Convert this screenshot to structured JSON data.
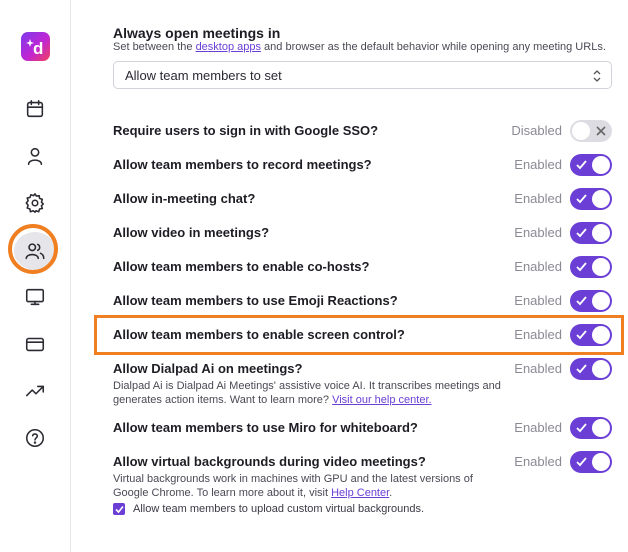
{
  "sidebar": {
    "logo_letter": "d",
    "items": [
      {
        "icon": "calendar-icon"
      },
      {
        "icon": "person-icon"
      },
      {
        "icon": "gear-icon"
      },
      {
        "icon": "users-icon",
        "active": true
      },
      {
        "icon": "monitor-icon"
      },
      {
        "icon": "credit-card-icon"
      },
      {
        "icon": "trending-up-icon"
      },
      {
        "icon": "help-icon"
      }
    ]
  },
  "meetings_setting": {
    "title": "Always open meetings in",
    "desc_before": "Set between the ",
    "desc_link": "desktop apps",
    "desc_after": " and browser as the default behavior while opening any meeting URLs.",
    "select_value": "Allow team members to set"
  },
  "settings": [
    {
      "label": "Require users to sign in with Google SSO?",
      "status": "Disabled",
      "enabled": false
    },
    {
      "label": "Allow team members to record meetings?",
      "status": "Enabled",
      "enabled": true
    },
    {
      "label": "Allow in-meeting chat?",
      "status": "Enabled",
      "enabled": true
    },
    {
      "label": "Allow video in meetings?",
      "status": "Enabled",
      "enabled": true
    },
    {
      "label": "Allow team members to enable co-hosts?",
      "status": "Enabled",
      "enabled": true
    },
    {
      "label": "Allow team members to use Emoji Reactions?",
      "status": "Enabled",
      "enabled": true
    },
    {
      "label": "Allow team members to enable screen control?",
      "status": "Enabled",
      "enabled": true
    },
    {
      "label": "Allow Dialpad Ai on meetings?",
      "status": "Enabled",
      "enabled": true,
      "desc_before": "Dialpad Ai is Dialpad Ai Meetings' assistive voice AI. It transcribes meetings and generates action items. Want to learn more? ",
      "desc_link": "Visit our help center.",
      "desc_after": ""
    },
    {
      "label": "Allow team members to use Miro for whiteboard?",
      "status": "Enabled",
      "enabled": true
    },
    {
      "label": "Allow virtual backgrounds during video meetings?",
      "status": "Enabled",
      "enabled": true,
      "desc_before": "Virtual backgrounds work in machines with GPU and the latest versions of Google Chrome. To learn more about it, visit ",
      "desc_link": "Help Center",
      "desc_after": "."
    }
  ],
  "custom_backgrounds": {
    "checked": true,
    "label": "Allow team members to upload custom virtual backgrounds."
  },
  "colors": {
    "accent": "#6b3fd6",
    "highlight": "#f07f21"
  }
}
